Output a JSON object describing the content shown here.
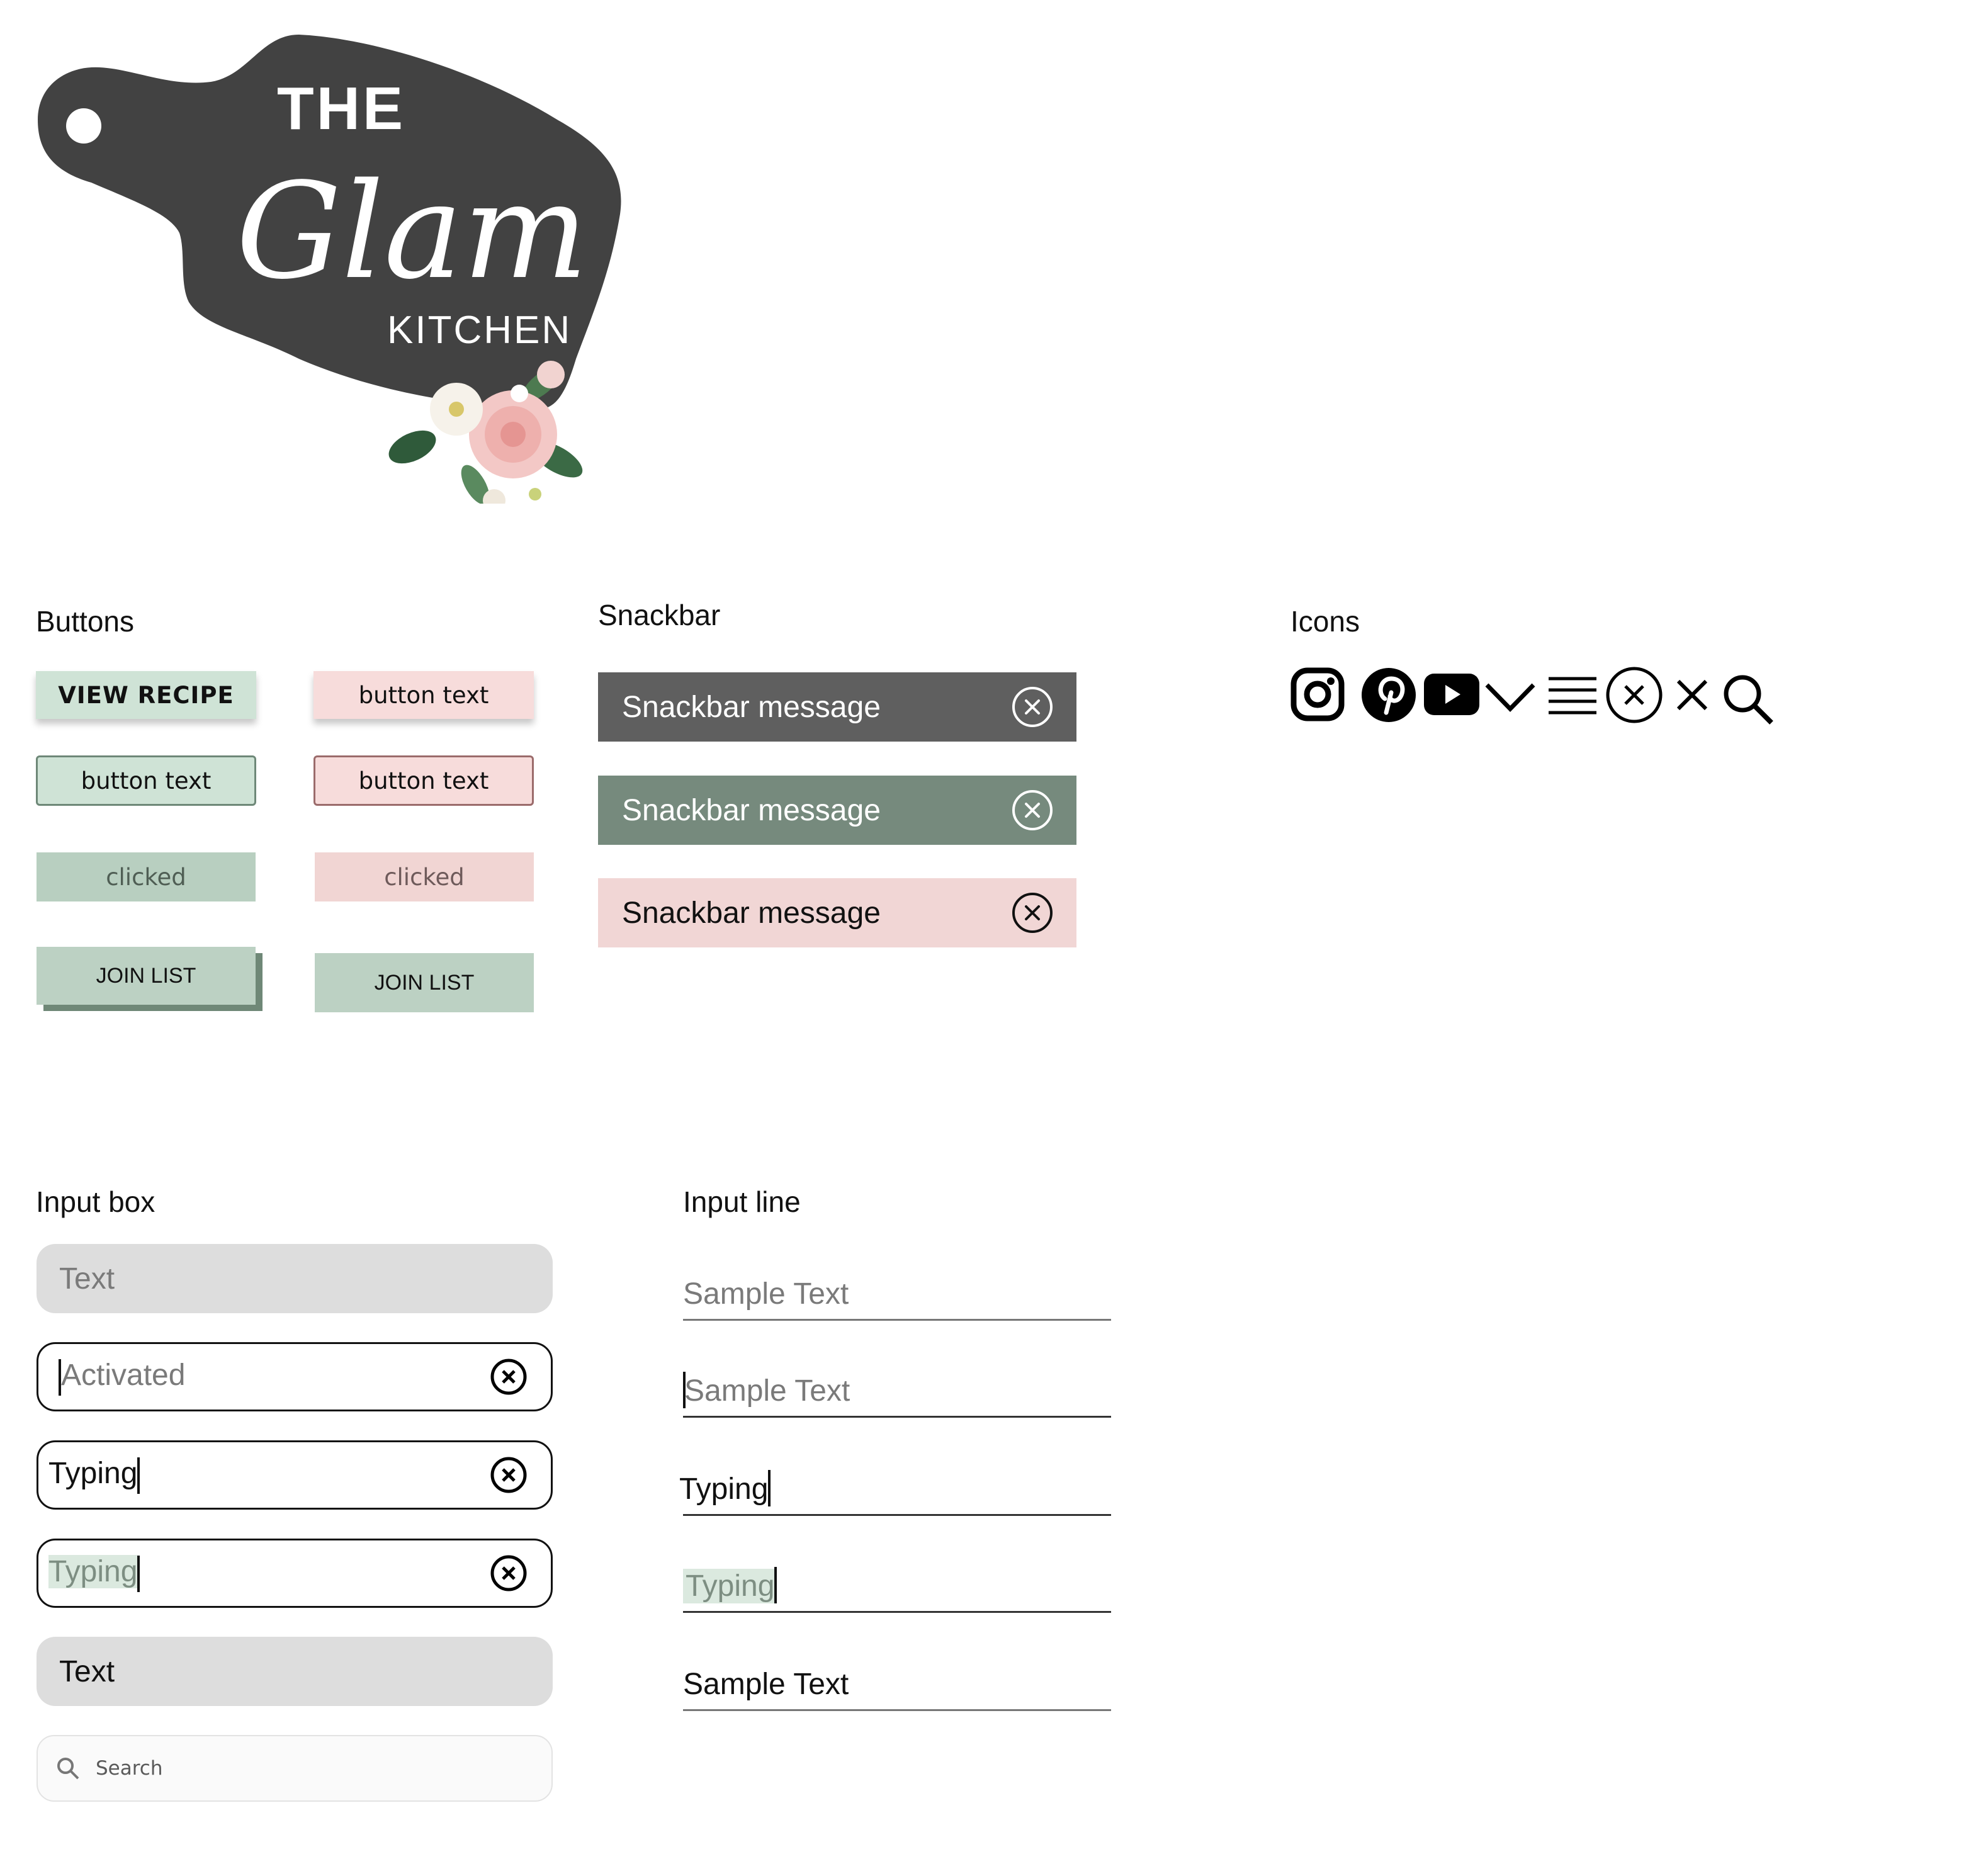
{
  "logo": {
    "brand_top": "THE",
    "brand_main": "Glam",
    "brand_bottom": "KITCHEN",
    "board_color": "#424242"
  },
  "buttons": {
    "heading": "Buttons",
    "view_recipe": "VIEW RECIPE",
    "button_text": "button text",
    "clicked": "clicked",
    "join_list": "JOIN LIST",
    "colors": {
      "green": "#cfe3d6",
      "pink": "#f7dcdb",
      "sage": "#bcd1c3"
    }
  },
  "snackbar": {
    "heading": "Snackbar",
    "message": "Snackbar message",
    "colors": {
      "dark": "#5f5f5f",
      "green": "#768a7d",
      "pink": "#f1d6d5"
    }
  },
  "icons": {
    "heading": "Icons",
    "items": [
      "instagram-icon",
      "pinterest-icon",
      "youtube-icon",
      "chevron-down-icon",
      "menu-icon",
      "close-circle-icon",
      "close-icon",
      "search-icon"
    ]
  },
  "input_box": {
    "heading": "Input box",
    "default_text": "Text",
    "activated_placeholder": "Activated",
    "typing": "Typing",
    "filled_text": "Text",
    "search_placeholder": "Search"
  },
  "input_line": {
    "heading": "Input line",
    "placeholder": "Sample Text",
    "typing": "Typing",
    "filled_text": "Sample Text"
  }
}
